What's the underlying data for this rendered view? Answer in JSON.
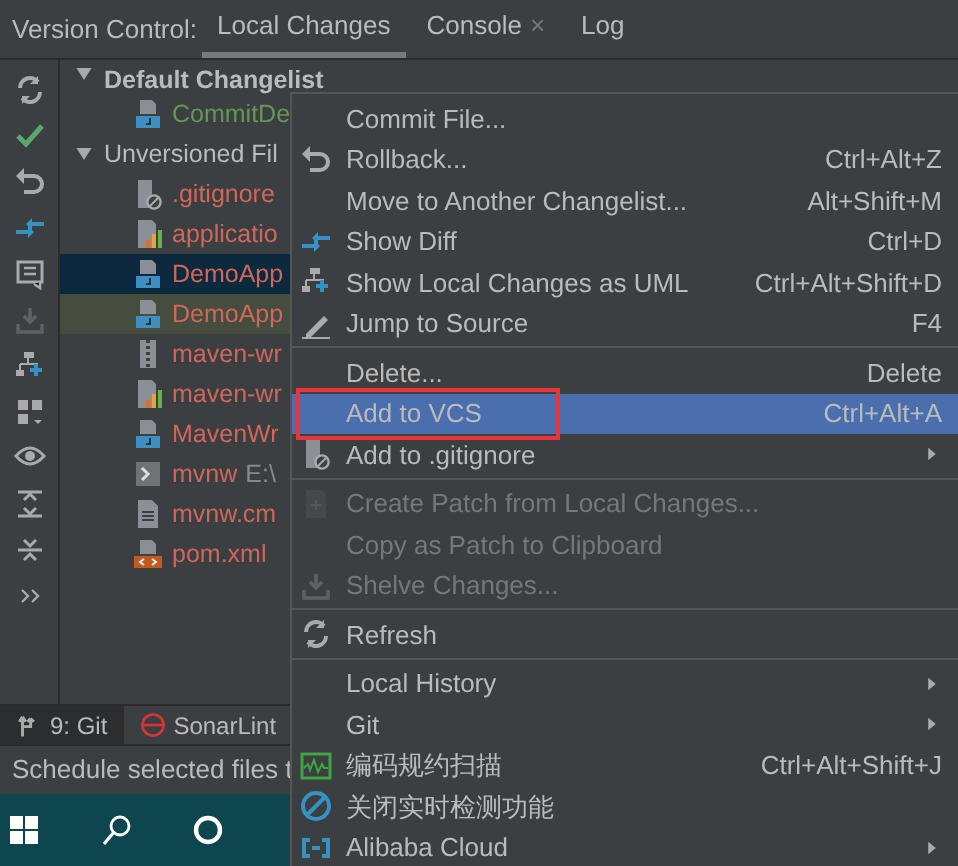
{
  "tool_window": {
    "title": "Version Control:",
    "tabs": [
      {
        "label": "Local Changes",
        "selected": true,
        "closable": false
      },
      {
        "label": "Console",
        "selected": false,
        "closable": true,
        "close": "×"
      },
      {
        "label": "Log",
        "selected": false,
        "closable": false
      }
    ]
  },
  "toolbar": [
    {
      "disabled": false
    },
    {
      "disabled": false
    },
    {
      "disabled": false
    },
    {
      "disabled": false
    },
    {
      "disabled": false
    },
    {
      "disabled": true
    },
    {
      "disabled": false
    },
    {
      "disabled": false
    },
    {
      "disabled": false
    },
    {
      "disabled": false
    },
    {
      "disabled": false
    },
    {
      "disabled": false
    }
  ],
  "tree": [
    {
      "label": "Default Changelist",
      "expanded": true,
      "children": [
        {
          "label": "CommitDe",
          "selected": false
        }
      ]
    },
    {
      "label": "Unversioned Fil",
      "expanded": true,
      "children": [
        {
          "label": ".gitignore",
          "selected": false
        },
        {
          "label": "applicatio",
          "selected": false
        },
        {
          "label": "DemoApp",
          "selected": true
        },
        {
          "label": "DemoApp",
          "selected": false
        },
        {
          "label": "maven-wr",
          "selected": false
        },
        {
          "label": "maven-wr",
          "selected": false
        },
        {
          "label": "MavenWr",
          "selected": false
        },
        {
          "label": "mvnw",
          "note": "E:\\",
          "selected": false
        },
        {
          "label": "mvnw.cm",
          "selected": false
        },
        {
          "label": "pom.xml",
          "selected": false
        }
      ]
    }
  ],
  "bottom_tabs": [
    {
      "label": "9: Git",
      "selected": true
    },
    {
      "label": "SonarLint",
      "selected": false
    }
  ],
  "status_bar": "Schedule selected files t",
  "context_menu": [
    {
      "kind": "item",
      "label": "Commit File...",
      "disabled": false,
      "selected": false
    },
    {
      "kind": "item",
      "label": "Rollback...",
      "shortcut": "Ctrl+Alt+Z",
      "disabled": false,
      "selected": false
    },
    {
      "kind": "item",
      "label": "Move to Another Changelist...",
      "shortcut": "Alt+Shift+M",
      "disabled": false,
      "selected": false
    },
    {
      "kind": "item",
      "label": "Show Diff",
      "shortcut": "Ctrl+D",
      "disabled": false,
      "selected": false
    },
    {
      "kind": "item",
      "label": "Show Local Changes as UML",
      "shortcut": "Ctrl+Alt+Shift+D",
      "disabled": false,
      "selected": false
    },
    {
      "kind": "item",
      "label": "Jump to Source",
      "shortcut": "F4",
      "disabled": false,
      "selected": false
    },
    {
      "kind": "separator"
    },
    {
      "kind": "item",
      "label": "Delete...",
      "shortcut": "Delete",
      "disabled": false,
      "selected": false
    },
    {
      "kind": "item",
      "label": "Add to VCS",
      "shortcut": "Ctrl+Alt+A",
      "disabled": false,
      "selected": true,
      "outlined": true
    },
    {
      "kind": "item",
      "label": "Add to .gitignore",
      "submenu": true,
      "disabled": false,
      "selected": false
    },
    {
      "kind": "separator"
    },
    {
      "kind": "item",
      "label": "Create Patch from Local Changes...",
      "disabled": true,
      "selected": false
    },
    {
      "kind": "item",
      "label": "Copy as Patch to Clipboard",
      "disabled": true,
      "selected": false
    },
    {
      "kind": "item",
      "label": "Shelve Changes...",
      "disabled": true,
      "selected": false
    },
    {
      "kind": "separator"
    },
    {
      "kind": "item",
      "label": "Refresh",
      "disabled": false,
      "selected": false
    },
    {
      "kind": "separator"
    },
    {
      "kind": "item",
      "label": "Local History",
      "submenu": true,
      "disabled": false,
      "selected": false
    },
    {
      "kind": "item",
      "label": "Git",
      "submenu": true,
      "disabled": false,
      "selected": false
    },
    {
      "kind": "item",
      "label": "编码规约扫描",
      "shortcut": "Ctrl+Alt+Shift+J",
      "disabled": false,
      "selected": false
    },
    {
      "kind": "item",
      "label": "关闭实时检测功能",
      "disabled": false,
      "selected": false
    },
    {
      "kind": "item",
      "label": "Alibaba Cloud",
      "submenu": true,
      "disabled": false,
      "selected": false
    }
  ]
}
